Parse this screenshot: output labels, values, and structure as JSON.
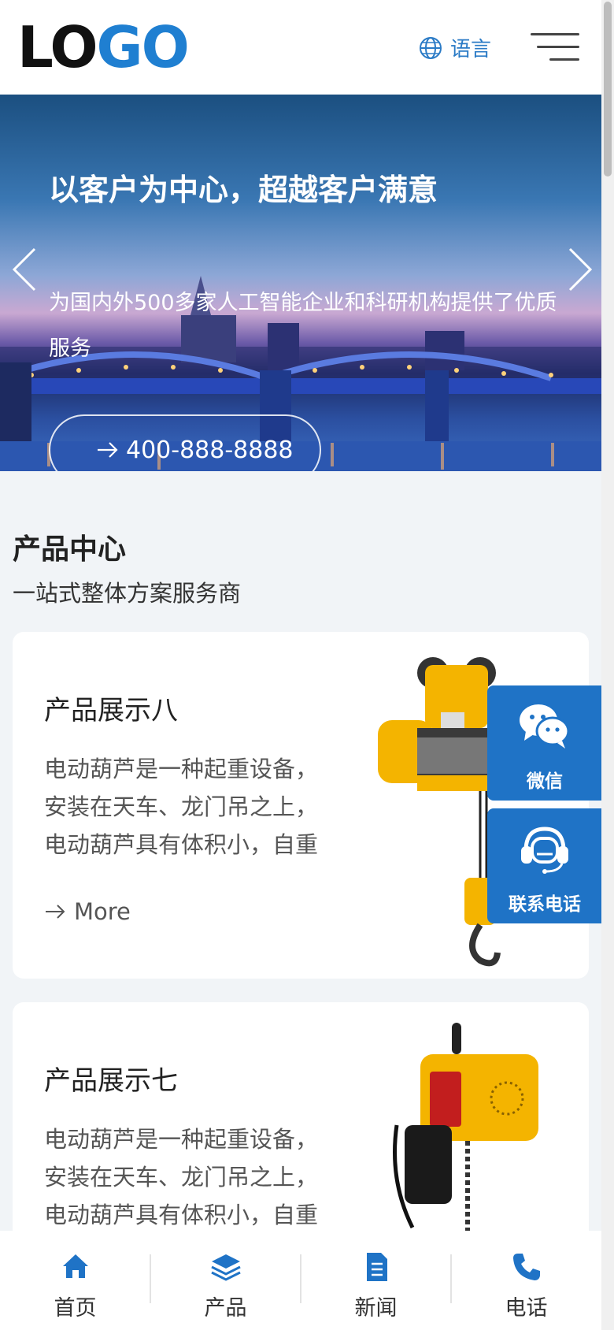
{
  "header": {
    "logo_left": "LO",
    "logo_right": "GO",
    "language_label": "语言"
  },
  "banner": {
    "title": "以客户为中心，超越客户满意",
    "subtitle_line1": "为国内外500多家人工智能企业和科研机构提供了优质",
    "subtitle_line2": "服务",
    "phone": "400-888-8888"
  },
  "products": {
    "title": "产品中心",
    "subtitle": "一站式整体方案服务商",
    "items": [
      {
        "title": "产品展示八",
        "desc": [
          "电动葫芦是一种起重设备，",
          "安装在天车、龙门吊之上，",
          "电动葫芦具有体积小，自重"
        ],
        "more": "More"
      },
      {
        "title": "产品展示七",
        "desc": [
          "电动葫芦是一种起重设备，",
          "安装在天车、龙门吊之上，",
          "电动葫芦具有体积小，自重"
        ]
      }
    ]
  },
  "float": {
    "wechat": "微信",
    "phone": "联系电话"
  },
  "nav": {
    "items": [
      {
        "label": "首页",
        "icon": "home-icon"
      },
      {
        "label": "产品",
        "icon": "layers-icon"
      },
      {
        "label": "新闻",
        "icon": "document-icon"
      },
      {
        "label": "电话",
        "icon": "phone-icon"
      }
    ]
  },
  "colors": {
    "accent": "#1f73c6",
    "logo_blue": "#1f7fd1",
    "background": "#f1f4f7"
  }
}
